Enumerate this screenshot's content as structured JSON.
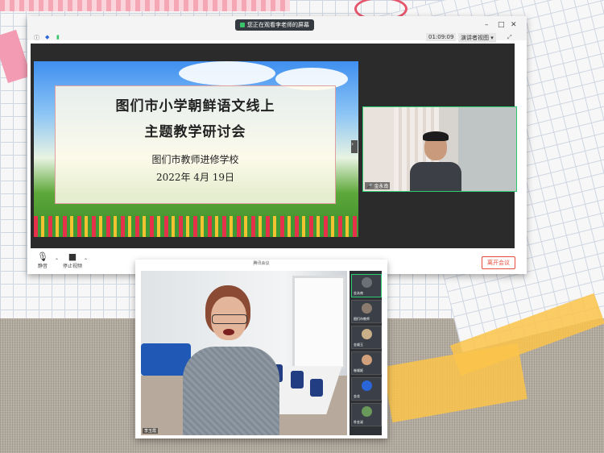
{
  "main_window": {
    "share_notice": "您正在观看李老师的屏幕",
    "timer": "01:09:09",
    "view_button": "演讲者视图",
    "slide": {
      "title_line1": "图们市小学朝鲜语文线上",
      "title_line2": "主题教学研讨会",
      "organizer": "图们市教师进修学校",
      "date": "2022年  4月  19日"
    },
    "speaker": {
      "name": "金永南"
    },
    "toolbar": {
      "mute_label": "静音",
      "video_label": "停止视频",
      "leave_label": "离开会议"
    }
  },
  "second_window": {
    "title": "腾讯会议",
    "main_speaker_name": "李玉霞",
    "thumbnails": [
      {
        "name": "金永南",
        "color": "#6b6f76"
      },
      {
        "name": "图们市教师",
        "color": "#8a7b6e"
      },
      {
        "name": "金顺玉",
        "color": "#c9b089"
      },
      {
        "name": "崔顺姬",
        "color": "#d2a07a"
      },
      {
        "name": "金花",
        "color": "#2a66d8"
      },
      {
        "name": "朴金淑",
        "color": "#6a9a5a"
      }
    ]
  },
  "colors": {
    "accent_green": "#2ecc71",
    "leave_red": "#e74c3c"
  }
}
